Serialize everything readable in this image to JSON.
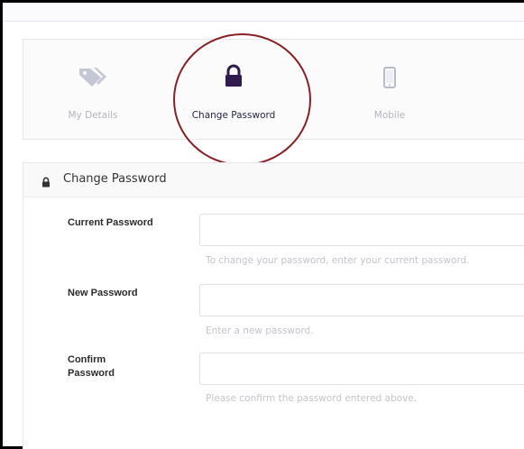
{
  "tabs": [
    {
      "label": "My Details",
      "icon": "tag-icon",
      "active": false
    },
    {
      "label": "Change Password",
      "icon": "lock-icon",
      "active": true
    },
    {
      "label": "Mobile",
      "icon": "mobile-phone-icon",
      "active": false
    }
  ],
  "section": {
    "title": "Change Password",
    "icon": "lock-icon"
  },
  "form": {
    "current": {
      "label": "Current Password",
      "help": "To change your password, enter your current password."
    },
    "new": {
      "label": "New Password",
      "help": "Enter a new password."
    },
    "confirm": {
      "label": "Confirm Password",
      "help": "Please confirm the password entered above."
    }
  },
  "colors": {
    "active_tab": "#2f1b4d",
    "inactive_tab": "#b7bac9",
    "highlight_circle": "#8a1f24"
  }
}
